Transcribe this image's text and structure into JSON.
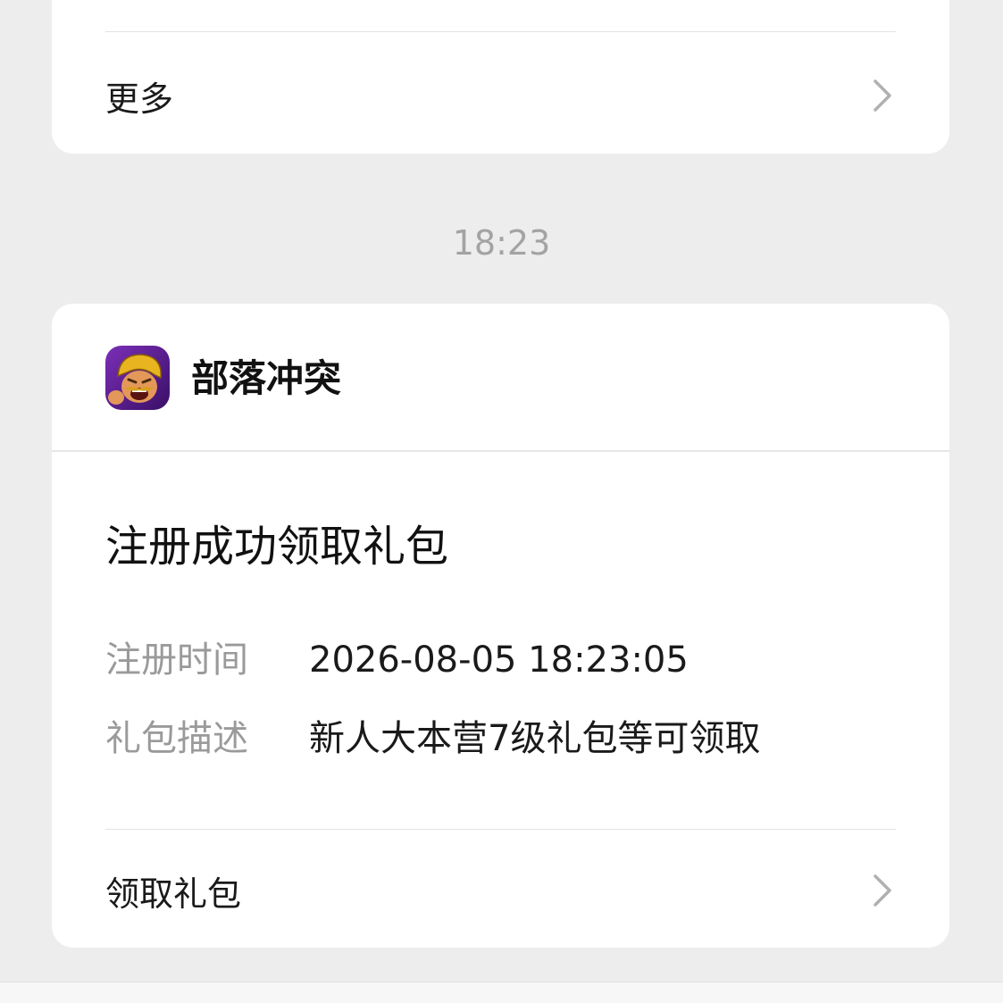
{
  "previous_card": {
    "more_label": "更多"
  },
  "timestamp": "18:23",
  "notification": {
    "app_name": "部落冲突",
    "app_icon": "clash-of-clans-app-icon",
    "title": "注册成功领取礼包",
    "fields": [
      {
        "key": "注册时间",
        "value": "2026-08-05 18:23:05"
      },
      {
        "key": "礼包描述",
        "value": "新人大本营7级礼包等可领取"
      }
    ],
    "action_label": "领取礼包"
  },
  "colors": {
    "background": "#ededed",
    "card": "#ffffff",
    "muted_text": "#9a9a9a",
    "primary_text": "#111111"
  }
}
